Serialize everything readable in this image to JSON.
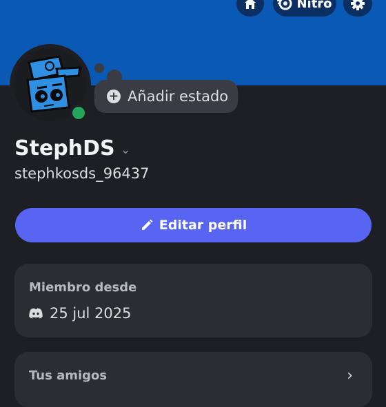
{
  "header": {
    "nitro_label": "Nitro",
    "home_icon": "home-icon",
    "nitro_icon": "nitro-icon",
    "settings_icon": "gear-icon",
    "banner_color": "#0a5ab5"
  },
  "profile": {
    "status_button_label": "Añadir estado",
    "display_name": "StephDS",
    "username": "stephkosds_96437",
    "online_status_color": "#23a55a"
  },
  "actions": {
    "edit_profile_label": "Editar perfil",
    "accent_color": "#5865f2"
  },
  "member_since": {
    "title": "Miembro desde",
    "date": "25 jul 2025",
    "icon": "discord-icon"
  },
  "friends": {
    "title": "Tus amigos",
    "icon": "chevron-right-icon"
  }
}
